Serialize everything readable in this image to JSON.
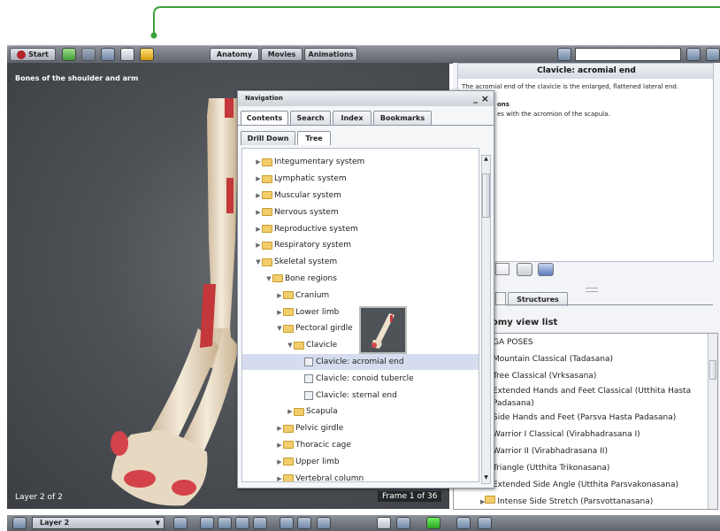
{
  "top_toolbar": {
    "start_label": "Start",
    "tabs": [
      "Anatomy",
      "Movies",
      "Animations"
    ]
  },
  "viewer": {
    "title": "Bones of the shoulder and arm",
    "layer_status": "Layer 2 of 2",
    "frame_status": "Frame 1 of 36"
  },
  "info_panel": {
    "title": "Clavicle: acromial end",
    "line1": "The acromial end of the clavicle is the enlarged, flattened lateral end.",
    "heading_fragment": "ons",
    "line2": "es with the acromion of the scapula."
  },
  "right_tabs": {
    "structures": "Structures"
  },
  "view_list": {
    "title": "omy view list",
    "items": [
      "GA POSES",
      "Mountain Classical (Tadasana)",
      "Tree Classical (Vrksasana)",
      "Extended Hands and Feet Classical (Utthita Hasta",
      "Padasana)",
      "Side Hands and Feet (Parsva Hasta Padasana)",
      "Warrior I Classical (Virabhadrasana I)",
      "Warrior II (Virabhadrasana II)",
      "Triangle (Utthita Trikonasana)",
      "Extended Side Angle (Utthita Parsvakonasana)",
      "Intense Side Stretch (Parsvottanasana)"
    ]
  },
  "navigation": {
    "title": "Navigation",
    "minimize": "_",
    "close": "×",
    "tabs": [
      "Contents",
      "Search",
      "Index",
      "Bookmarks"
    ],
    "subtabs": [
      "Drill Down",
      "Tree"
    ],
    "tree": [
      {
        "label": "Integumentary system",
        "level": 0,
        "kind": "folder",
        "expanded": false
      },
      {
        "label": "Lymphatic system",
        "level": 0,
        "kind": "folder",
        "expanded": false
      },
      {
        "label": "Muscular system",
        "level": 0,
        "kind": "folder",
        "expanded": false
      },
      {
        "label": "Nervous system",
        "level": 0,
        "kind": "folder",
        "expanded": false
      },
      {
        "label": "Reproductive system",
        "level": 0,
        "kind": "folder",
        "expanded": false
      },
      {
        "label": "Respiratory system",
        "level": 0,
        "kind": "folder",
        "expanded": false
      },
      {
        "label": "Skeletal system",
        "level": 0,
        "kind": "folder",
        "expanded": true
      },
      {
        "label": "Bone regions",
        "level": 1,
        "kind": "folder",
        "expanded": true
      },
      {
        "label": "Cranium",
        "level": 2,
        "kind": "folder",
        "expanded": false
      },
      {
        "label": "Lower limb",
        "level": 2,
        "kind": "folder",
        "expanded": false
      },
      {
        "label": "Pectoral girdle",
        "level": 2,
        "kind": "folder",
        "expanded": true
      },
      {
        "label": "Clavicle",
        "level": 3,
        "kind": "folder",
        "expanded": true
      },
      {
        "label": "Clavicle: acromial end",
        "level": 4,
        "kind": "doc",
        "selected": true
      },
      {
        "label": "Clavicle: conoid tubercle",
        "level": 4,
        "kind": "doc"
      },
      {
        "label": "Clavicle: sternal end",
        "level": 4,
        "kind": "doc"
      },
      {
        "label": "Scapula",
        "level": 3,
        "kind": "folder",
        "expanded": false
      },
      {
        "label": "Pelvic girdle",
        "level": 2,
        "kind": "folder",
        "expanded": false
      },
      {
        "label": "Thoracic cage",
        "level": 2,
        "kind": "folder",
        "expanded": false
      },
      {
        "label": "Upper limb",
        "level": 2,
        "kind": "folder",
        "expanded": false
      },
      {
        "label": "Vertebral column",
        "level": 2,
        "kind": "folder",
        "expanded": false
      }
    ]
  },
  "bottom_bar": {
    "layer_select": "Layer 2"
  },
  "colors": {
    "callout_green": "#3aa23a",
    "toolbar_dark": "#5d6169",
    "selection": "#d6dcef",
    "bone_red": "#c4373a"
  }
}
